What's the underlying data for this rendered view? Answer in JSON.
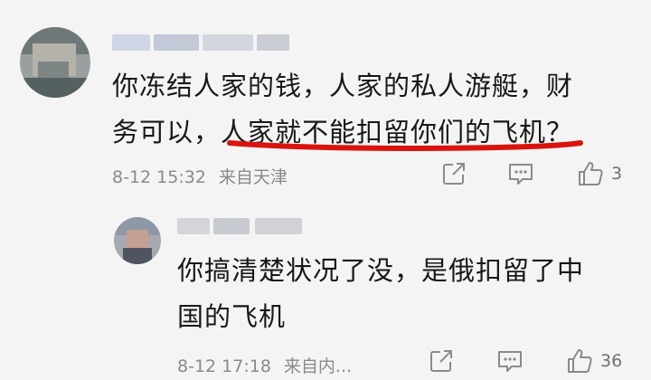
{
  "comments": [
    {
      "line1": "你冻结人家的钱，人家的私人游艇，财",
      "line2_prefix": "务可以，",
      "line2_highlight": "人家就不能扣留你们的飞机",
      "line2_suffix": "？",
      "time": "8-12 15:32",
      "location": "来自天津",
      "likes": "3"
    },
    {
      "line1": "你搞清楚状况了没，是俄扣留了中",
      "line2": "国的飞机",
      "time": "8-12 17:18",
      "location": "来自内...",
      "likes": "36"
    }
  ],
  "colors": {
    "highlight_line": "#d9140f",
    "icon": "#8a8a8a"
  },
  "icons": [
    "share-icon",
    "comment-icon",
    "like-icon"
  ]
}
